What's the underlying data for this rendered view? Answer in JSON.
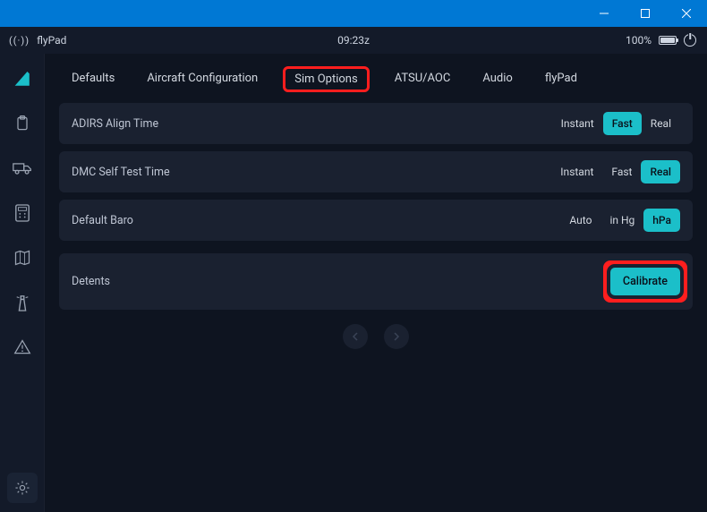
{
  "titlebar": {},
  "status": {
    "app_name": "flyPad",
    "time": "09:23z",
    "battery_pct": "100%"
  },
  "sidebar": {
    "items": [
      {
        "name": "home-tail-icon",
        "active": true
      },
      {
        "name": "clipboard-icon",
        "active": false
      },
      {
        "name": "truck-icon",
        "active": false
      },
      {
        "name": "calculator-icon",
        "active": false
      },
      {
        "name": "map-icon",
        "active": false
      },
      {
        "name": "lighthouse-icon",
        "active": false
      },
      {
        "name": "warning-icon",
        "active": false
      }
    ],
    "footer": {
      "name": "gear-icon"
    }
  },
  "tabs": [
    {
      "label": "Defaults",
      "active": false
    },
    {
      "label": "Aircraft Configuration",
      "active": false
    },
    {
      "label": "Sim Options",
      "active": true,
      "highlighted": true
    },
    {
      "label": "ATSU/AOC",
      "active": false
    },
    {
      "label": "Audio",
      "active": false
    },
    {
      "label": "flyPad",
      "active": false
    }
  ],
  "rows": [
    {
      "label": "ADIRS Align Time",
      "options": [
        "Instant",
        "Fast",
        "Real"
      ],
      "selected": "Fast"
    },
    {
      "label": "DMC Self Test Time",
      "options": [
        "Instant",
        "Fast",
        "Real"
      ],
      "selected": "Real"
    },
    {
      "label": "Default Baro",
      "options": [
        "Auto",
        "in Hg",
        "hPa"
      ],
      "selected": "hPa"
    }
  ],
  "detents": {
    "label": "Detents",
    "button": "Calibrate"
  },
  "colors": {
    "accent": "#1bbfc9",
    "highlight": "#ff1e1e",
    "bg": "#0e1420",
    "panel": "#1a2130",
    "titlebar": "#0078d4"
  }
}
